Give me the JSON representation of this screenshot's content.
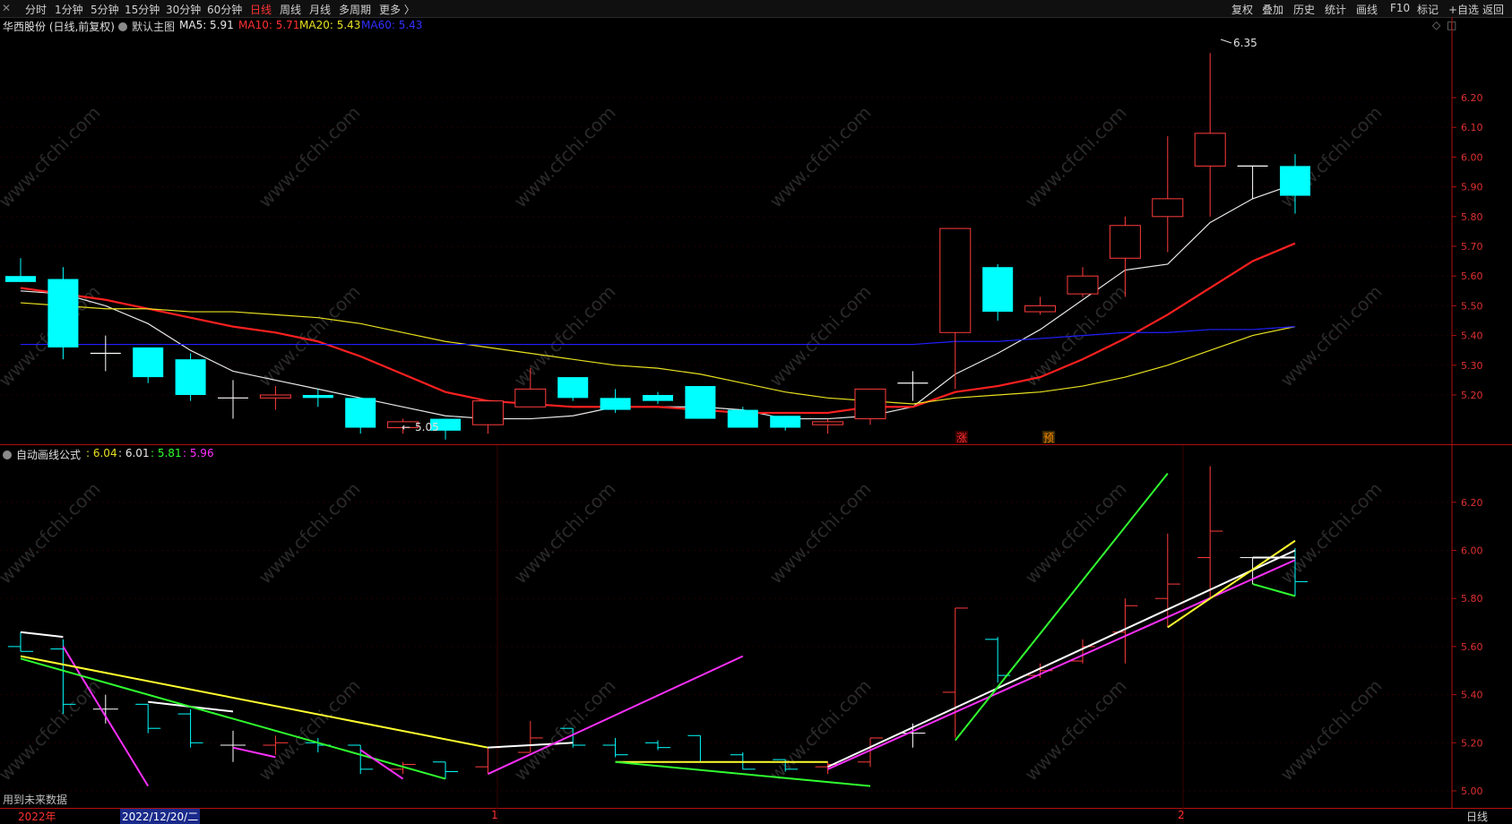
{
  "toolbar": {
    "left_items": [
      "分时",
      "1分钟",
      "5分钟",
      "15分钟",
      "30分钟",
      "60分钟",
      "日线",
      "周线",
      "月线",
      "多周期",
      "更多 〉"
    ],
    "active_item": "日线",
    "right_items": [
      "复权",
      "叠加",
      "历史",
      "统计",
      "画线",
      "F10",
      "标记",
      "+自选",
      "返回"
    ]
  },
  "main_chart": {
    "title": "华西股份 (日线,前复权)",
    "template": "默认主图",
    "ma5": "MA5: 5.91",
    "ma10": "MA10: 5.71",
    "ma20": "MA20: 5.43",
    "ma60": "MA60: 5.43",
    "high_marker": "6.35",
    "low_marker": "5.05",
    "flag_zhang": "涨",
    "flag_yu": "预",
    "y_ticks": [
      "6.20",
      "6.10",
      "6.00",
      "5.90",
      "5.80",
      "5.70",
      "5.60",
      "5.50",
      "5.40",
      "5.30",
      "5.20"
    ]
  },
  "indicator_chart": {
    "name": "自动画线公式",
    "v1": ": 6.04",
    "v2": ": 6.01",
    "v3": ": 5.81",
    "v4": ": 5.96",
    "note": "用到未来数据",
    "y_ticks": [
      "6.20",
      "6.00",
      "5.80",
      "5.60",
      "5.40",
      "5.20",
      "5.00"
    ]
  },
  "bottom": {
    "year": "2022年",
    "cursor_date": "2022/12/20/二",
    "month1": "1",
    "month2": "2",
    "period": "日线"
  },
  "watermark": "www.cfchi.com",
  "colors": {
    "up": "#ff3c3c",
    "down": "#00ffff",
    "ma5": "#e8e8e8",
    "ma10": "#ff2020",
    "ma20": "#e8e020",
    "ma60": "#2020ff"
  },
  "chart_data": [
    {
      "type": "candlestick",
      "title": "华西股份 (日线,前复权)",
      "ylim": [
        5.0,
        6.35
      ],
      "candles": [
        {
          "o": 5.6,
          "c": 5.58,
          "h": 5.66,
          "l": 5.58
        },
        {
          "o": 5.59,
          "c": 5.36,
          "h": 5.63,
          "l": 5.32
        },
        {
          "o": 5.34,
          "c": 5.34,
          "h": 5.4,
          "l": 5.28
        },
        {
          "o": 5.36,
          "c": 5.26,
          "h": 5.36,
          "l": 5.24
        },
        {
          "o": 5.32,
          "c": 5.2,
          "h": 5.34,
          "l": 5.18
        },
        {
          "o": 5.19,
          "c": 5.19,
          "h": 5.25,
          "l": 5.12
        },
        {
          "o": 5.19,
          "c": 5.2,
          "h": 5.23,
          "l": 5.15
        },
        {
          "o": 5.2,
          "c": 5.19,
          "h": 5.22,
          "l": 5.16
        },
        {
          "o": 5.19,
          "c": 5.09,
          "h": 5.19,
          "l": 5.07
        },
        {
          "o": 5.09,
          "c": 5.11,
          "h": 5.12,
          "l": 5.07
        },
        {
          "o": 5.12,
          "c": 5.08,
          "h": 5.12,
          "l": 5.05
        },
        {
          "o": 5.1,
          "c": 5.18,
          "h": 5.18,
          "l": 5.07
        },
        {
          "o": 5.16,
          "c": 5.22,
          "h": 5.29,
          "l": 5.16
        },
        {
          "o": 5.26,
          "c": 5.19,
          "h": 5.26,
          "l": 5.18
        },
        {
          "o": 5.19,
          "c": 5.15,
          "h": 5.22,
          "l": 5.14
        },
        {
          "o": 5.2,
          "c": 5.18,
          "h": 5.21,
          "l": 5.17
        },
        {
          "o": 5.23,
          "c": 5.12,
          "h": 5.23,
          "l": 5.12
        },
        {
          "o": 5.15,
          "c": 5.09,
          "h": 5.16,
          "l": 5.09
        },
        {
          "o": 5.13,
          "c": 5.09,
          "h": 5.13,
          "l": 5.08
        },
        {
          "o": 5.1,
          "c": 5.11,
          "h": 5.12,
          "l": 5.07
        },
        {
          "o": 5.12,
          "c": 5.22,
          "h": 5.22,
          "l": 5.1
        },
        {
          "o": 5.24,
          "c": 5.24,
          "h": 5.28,
          "l": 5.18
        },
        {
          "o": 5.41,
          "c": 5.76,
          "h": 5.76,
          "l": 5.22
        },
        {
          "o": 5.63,
          "c": 5.48,
          "h": 5.64,
          "l": 5.45
        },
        {
          "o": 5.48,
          "c": 5.5,
          "h": 5.53,
          "l": 5.47
        },
        {
          "o": 5.54,
          "c": 5.6,
          "h": 5.63,
          "l": 5.53
        },
        {
          "o": 5.66,
          "c": 5.77,
          "h": 5.8,
          "l": 5.53
        },
        {
          "o": 5.8,
          "c": 5.86,
          "h": 6.07,
          "l": 5.68
        },
        {
          "o": 5.97,
          "c": 6.08,
          "h": 6.35,
          "l": 5.8
        },
        {
          "o": 5.97,
          "c": 5.97,
          "h": 5.97,
          "l": 5.86
        },
        {
          "o": 5.97,
          "c": 5.87,
          "h": 6.01,
          "l": 5.81
        }
      ],
      "series": [
        {
          "name": "MA5",
          "values": [
            5.55,
            5.54,
            5.5,
            5.44,
            5.35,
            5.28,
            5.25,
            5.22,
            5.19,
            5.16,
            5.13,
            5.12,
            5.12,
            5.13,
            5.16,
            5.16,
            5.16,
            5.15,
            5.12,
            5.12,
            5.13,
            5.16,
            5.27,
            5.34,
            5.42,
            5.52,
            5.62,
            5.64,
            5.78,
            5.86,
            5.91
          ]
        },
        {
          "name": "MA10",
          "values": [
            5.56,
            5.54,
            5.52,
            5.49,
            5.46,
            5.43,
            5.41,
            5.38,
            5.33,
            5.27,
            5.21,
            5.18,
            5.17,
            5.16,
            5.16,
            5.16,
            5.15,
            5.14,
            5.14,
            5.14,
            5.16,
            5.16,
            5.21,
            5.23,
            5.26,
            5.32,
            5.39,
            5.47,
            5.56,
            5.65,
            5.71
          ]
        },
        {
          "name": "MA20",
          "values": [
            5.51,
            5.5,
            5.49,
            5.49,
            5.48,
            5.48,
            5.47,
            5.46,
            5.44,
            5.41,
            5.38,
            5.36,
            5.34,
            5.32,
            5.3,
            5.29,
            5.27,
            5.24,
            5.21,
            5.19,
            5.18,
            5.17,
            5.19,
            5.2,
            5.21,
            5.23,
            5.26,
            5.3,
            5.35,
            5.4,
            5.43
          ]
        },
        {
          "name": "MA60",
          "values": [
            5.37,
            5.37,
            5.37,
            5.37,
            5.37,
            5.37,
            5.37,
            5.37,
            5.37,
            5.37,
            5.37,
            5.37,
            5.37,
            5.37,
            5.37,
            5.37,
            5.37,
            5.37,
            5.37,
            5.37,
            5.37,
            5.37,
            5.38,
            5.38,
            5.39,
            5.4,
            5.41,
            5.41,
            5.42,
            5.42,
            5.43
          ]
        }
      ]
    },
    {
      "type": "line",
      "title": "自动画线公式",
      "ylim": [
        4.99,
        6.35
      ],
      "segments": [
        {
          "color": "#ffffff",
          "points": [
            [
              0,
              5.66
            ],
            [
              1,
              5.64
            ]
          ]
        },
        {
          "color": "#ff30ff",
          "points": [
            [
              1,
              5.6
            ],
            [
              3,
              5.02
            ]
          ]
        },
        {
          "color": "#ffffff",
          "points": [
            [
              3,
              5.37
            ],
            [
              5,
              5.33
            ]
          ]
        },
        {
          "color": "#ffff30",
          "points": [
            [
              0,
              5.56
            ],
            [
              11,
              5.18
            ]
          ]
        },
        {
          "color": "#30ff30",
          "points": [
            [
              0,
              5.55
            ],
            [
              10,
              5.05
            ]
          ]
        },
        {
          "color": "#ff30ff",
          "points": [
            [
              5,
              5.18
            ],
            [
              6,
              5.14
            ]
          ]
        },
        {
          "color": "#ff30ff",
          "points": [
            [
              8,
              5.17
            ],
            [
              9,
              5.05
            ]
          ]
        },
        {
          "color": "#ffffff",
          "points": [
            [
              11,
              5.18
            ],
            [
              13,
              5.2
            ]
          ]
        },
        {
          "color": "#ff30ff",
          "points": [
            [
              11,
              5.07
            ],
            [
              17,
              5.56
            ]
          ]
        },
        {
          "color": "#ffff30",
          "points": [
            [
              14,
              5.12
            ],
            [
              19,
              5.12
            ]
          ]
        },
        {
          "color": "#30ff30",
          "points": [
            [
              14,
              5.12
            ],
            [
              20,
              5.02
            ]
          ]
        },
        {
          "color": "#ffffff",
          "points": [
            [
              19,
              5.1
            ],
            [
              30,
              6.0
            ]
          ]
        },
        {
          "color": "#ff30ff",
          "points": [
            [
              19,
              5.09
            ],
            [
              30,
              5.96
            ]
          ]
        },
        {
          "color": "#30ff30",
          "points": [
            [
              22,
              5.21
            ],
            [
              27,
              6.32
            ]
          ]
        },
        {
          "color": "#ffff30",
          "points": [
            [
              27,
              5.68
            ],
            [
              30,
              6.04
            ]
          ]
        },
        {
          "color": "#30ff30",
          "points": [
            [
              29,
              5.86
            ],
            [
              30,
              5.81
            ]
          ]
        },
        {
          "color": "#ffffff",
          "points": [
            [
              29,
              5.97
            ],
            [
              30,
              5.97
            ]
          ]
        }
      ]
    }
  ]
}
